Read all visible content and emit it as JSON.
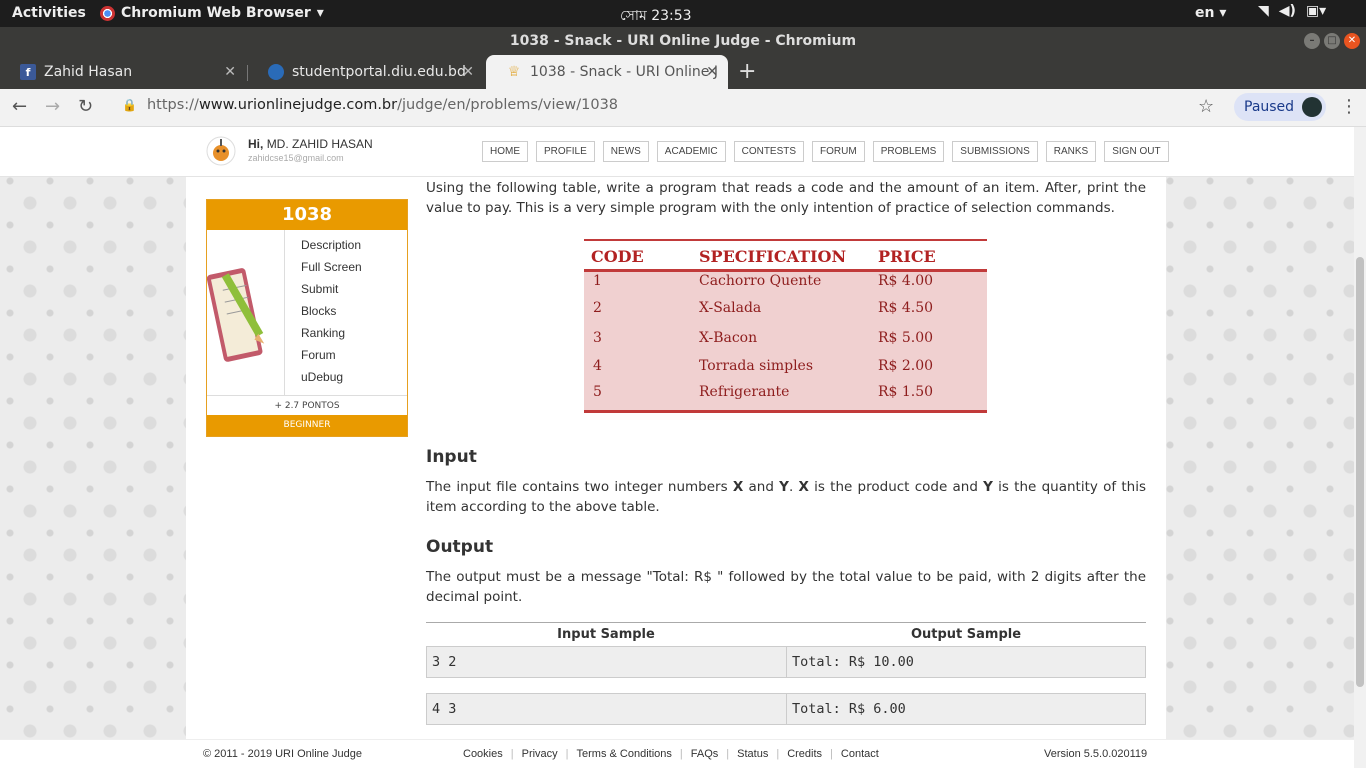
{
  "os": {
    "activities": "Activities",
    "app_name": "Chromium Web Browser",
    "clock": "সোম 23:53",
    "lang": "en"
  },
  "window": {
    "title": "1038 - Snack - URI Online Judge - Chromium"
  },
  "tabs": [
    {
      "label": "Zahid Hasan",
      "icon": "facebook-icon",
      "color": "#3b5998"
    },
    {
      "label": "studentportal.diu.edu.bd",
      "icon": "diu-icon",
      "color": "#2a6bb8"
    },
    {
      "label": "1038 - Snack - URI Online J",
      "icon": "uri-trophy-icon",
      "color": "#e0a020"
    }
  ],
  "toolbar": {
    "url_scheme": "https://",
    "url_host": "www.urionlinejudge.com.br",
    "url_path": "/judge/en/problems/view/1038",
    "profile_label": "Paused"
  },
  "site": {
    "greeting_prefix": "Hi,",
    "user_name": "MD. ZAHID HASAN",
    "user_email": "zahidcse15@gmail.com",
    "nav": [
      "HOME",
      "PROFILE",
      "NEWS",
      "ACADEMIC",
      "CONTESTS",
      "FORUM",
      "PROBLEMS",
      "SUBMISSIONS",
      "RANKS",
      "SIGN OUT"
    ]
  },
  "problem": {
    "id": "1038",
    "menu": [
      "Description",
      "Full Screen",
      "Submit",
      "Blocks",
      "Ranking",
      "Forum",
      "uDebug"
    ],
    "points": "+ 2.7 PONTOS",
    "level": "BEGINNER",
    "intro": "Using the following table, write a program that reads a code and the amount of an item. After, print the value to pay. This is a very simple program with the only intention of practice of selection commands.",
    "table": {
      "headers": [
        "CODE",
        "SPECIFICATION",
        "PRICE"
      ],
      "rows": [
        [
          "1",
          "Cachorro Quente",
          "R$ 4.00"
        ],
        [
          "2",
          "X-Salada",
          "R$ 4.50"
        ],
        [
          "3",
          "X-Bacon",
          "R$ 5.00"
        ],
        [
          "4",
          "Torrada simples",
          "R$ 2.00"
        ],
        [
          "5",
          "Refrigerante",
          "R$ 1.50"
        ]
      ]
    },
    "input_heading": "Input",
    "input_text_1": "The input file contains two integer numbers ",
    "input_x": "X",
    "input_and": " and ",
    "input_y": "Y",
    "input_dot": ". ",
    "input_x2": "X",
    "input_text_2": " is the product code and ",
    "input_y2": "Y",
    "input_text_3": " is the quantity of this item according to the above table.",
    "output_heading": "Output",
    "output_text": "The output must be a message \"Total: R$ \" followed by the total value to be paid, with 2 digits after the decimal point.",
    "samples_head": [
      "Input Sample",
      "Output Sample"
    ],
    "samples": [
      {
        "input": "3 2",
        "output": "Total: R$ 10.00"
      },
      {
        "input": "4 3",
        "output": "Total: R$ 6.00"
      }
    ]
  },
  "footer": {
    "copyright": "© 2011 - 2019 URI Online Judge",
    "links": [
      "Cookies",
      "Privacy",
      "Terms & Conditions",
      "FAQs",
      "Status",
      "Credits",
      "Contact"
    ],
    "version": "Version 5.5.0.020119"
  }
}
